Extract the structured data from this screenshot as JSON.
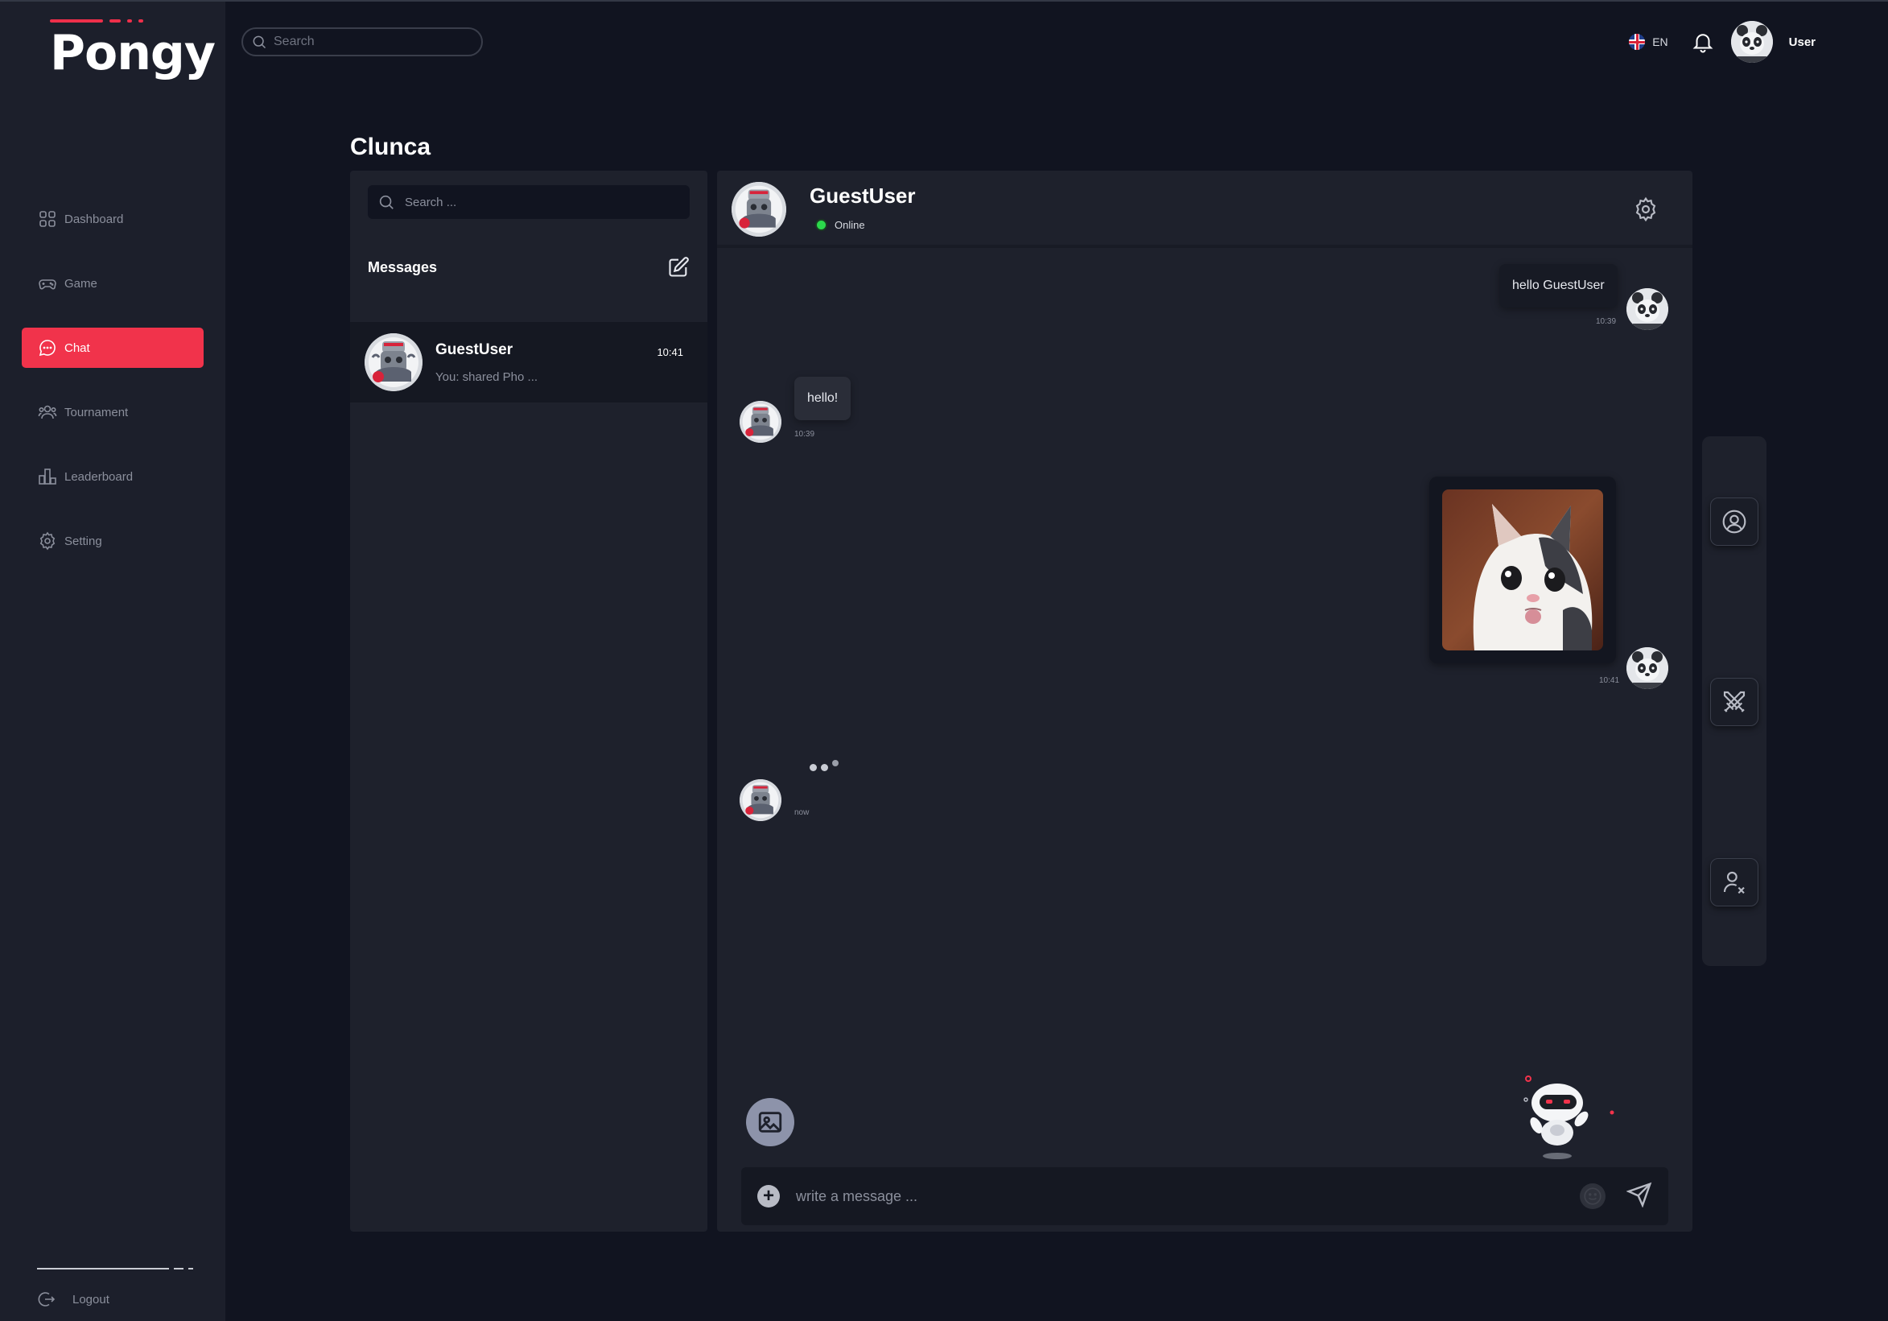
{
  "app": {
    "logo_text": "Pongy"
  },
  "top_bar": {
    "search_placeholder": "Search",
    "language": "EN",
    "user_name": "User"
  },
  "sidebar": {
    "items": [
      {
        "label": "Dashboard",
        "icon": "grid-icon",
        "active": false
      },
      {
        "label": "Game",
        "icon": "gamepad-icon",
        "active": false
      },
      {
        "label": "Chat",
        "icon": "chat-bubble-icon",
        "active": true
      },
      {
        "label": "Tournament",
        "icon": "users-icon",
        "active": false
      },
      {
        "label": "Leaderboard",
        "icon": "bar-chart-icon",
        "active": false
      },
      {
        "label": "Setting",
        "icon": "gear-icon",
        "active": false
      }
    ],
    "logout_label": "Logout"
  },
  "page": {
    "title": "Clunca"
  },
  "conversations": {
    "search_placeholder": "Search ...",
    "header": "Messages",
    "items": [
      {
        "name": "GuestUser",
        "preview": "You: shared Pho ...",
        "time": "10:41"
      }
    ]
  },
  "chat": {
    "contact_name": "GuestUser",
    "status": "Online",
    "messages": [
      {
        "direction": "outgoing",
        "text": "hello GuestUser",
        "time": "10:39"
      },
      {
        "direction": "incoming",
        "text": "hello!",
        "time": "10:39"
      },
      {
        "direction": "outgoing",
        "type": "image",
        "time": "10:41"
      },
      {
        "direction": "incoming",
        "type": "typing",
        "time": "now"
      }
    ],
    "composer_placeholder": "write a message ..."
  },
  "colors": {
    "accent": "#f1334b",
    "background": "#111420",
    "panel": "#1e212c",
    "online": "#2bd94c"
  }
}
